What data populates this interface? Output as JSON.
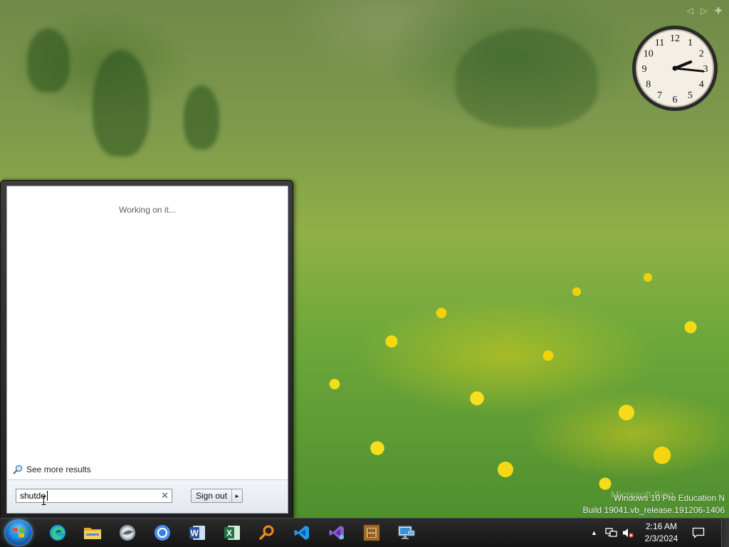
{
  "desktop": {
    "watermark_line1": "Windows 10 Pro Education N",
    "watermark_line2": "Build 19041.vb_release.191206-1406",
    "bing_mark": "Microsoft Bing"
  },
  "gadgets": {
    "clock": {
      "hour": 2,
      "minute": 16,
      "numerals": [
        "12",
        "1",
        "2",
        "3",
        "4",
        "5",
        "6",
        "7",
        "8",
        "9",
        "10",
        "11"
      ]
    },
    "toolbar_icons": [
      "previous-icon",
      "next-icon",
      "add-gadget-icon"
    ]
  },
  "start_menu": {
    "status_text": "Working on it...",
    "see_more_label": "See more results",
    "search": {
      "value": "shutdo",
      "clear_icon": "✕"
    },
    "power_button_label": "Sign out",
    "power_arrow_icon": "►"
  },
  "taskbar": {
    "pinned": [
      {
        "name": "edge",
        "icon": "edge-icon"
      },
      {
        "name": "file-explorer",
        "icon": "folder-icon"
      },
      {
        "name": "app-gray",
        "icon": "app-icon"
      },
      {
        "name": "chrome",
        "icon": "chrome-icon"
      },
      {
        "name": "word",
        "icon": "word-icon",
        "glyph": "W"
      },
      {
        "name": "excel",
        "icon": "excel-icon",
        "glyph": "X"
      },
      {
        "name": "search-tool",
        "icon": "magnifier-icon"
      },
      {
        "name": "vscode",
        "icon": "vscode-icon"
      },
      {
        "name": "visual-studio",
        "icon": "visual-studio-icon"
      },
      {
        "name": "dosbox",
        "icon": "dosbox-icon",
        "glyph": "DOS BOX"
      },
      {
        "name": "remote-desktop",
        "icon": "remote-desktop-icon"
      }
    ],
    "tray": {
      "show_hidden_icon": "▲",
      "time": "2:16 AM",
      "date": "2/3/2024"
    },
    "colors": {
      "word": "#2b579a",
      "excel": "#217346",
      "vscode": "#1f9cf0",
      "visual_studio": "#8b5fd3",
      "chrome_ring": "#4a8ff0",
      "edge": "#1fa3d6",
      "folder": "#f0c24a"
    }
  }
}
